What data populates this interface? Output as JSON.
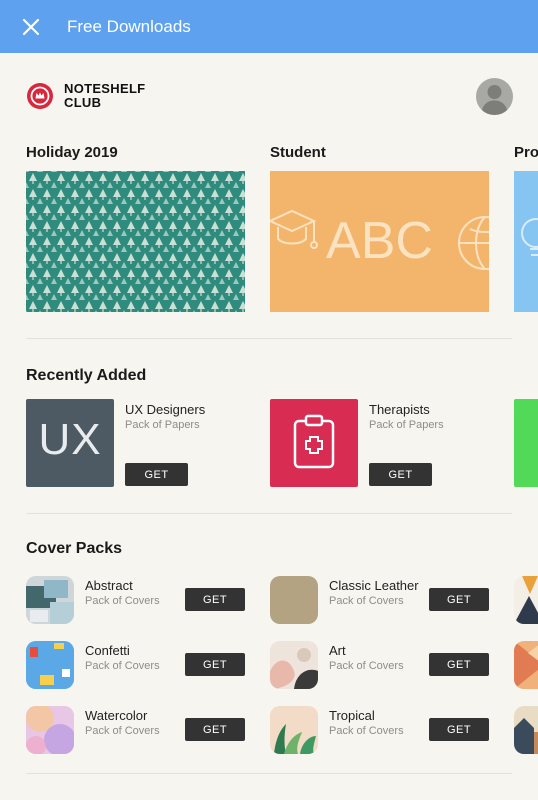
{
  "topbar": {
    "title": "Free Downloads"
  },
  "brand": {
    "line1": "NOTESHELF",
    "line2": "CLUB"
  },
  "featured": [
    {
      "label": "Holiday 2019"
    },
    {
      "label": "Student",
      "art_text": "ABC"
    },
    {
      "label": "Pro"
    }
  ],
  "recently_added": {
    "title": "Recently Added",
    "items": [
      {
        "title": "UX Designers",
        "subtitle": "Pack of Papers",
        "art_text": "UX",
        "action": "GET"
      },
      {
        "title": "Therapists",
        "subtitle": "Pack of Papers",
        "action": "GET"
      }
    ]
  },
  "cover_packs": {
    "title": "Cover Packs",
    "items": [
      {
        "title": "Abstract",
        "subtitle": "Pack of Covers",
        "action": "GET"
      },
      {
        "title": "Classic Leather",
        "subtitle": "Pack of Covers",
        "action": "GET"
      },
      {
        "title": "Confetti",
        "subtitle": "Pack of Covers",
        "action": "GET"
      },
      {
        "title": "Art",
        "subtitle": "Pack of Covers",
        "action": "GET"
      },
      {
        "title": "Watercolor",
        "subtitle": "Pack of Covers",
        "action": "GET"
      },
      {
        "title": "Tropical",
        "subtitle": "Pack of Covers",
        "action": "GET"
      }
    ]
  },
  "colors": {
    "topbar": "#5ea1ef",
    "background": "#f6f5ef",
    "button": "#333333",
    "brand_red": "#d8283e"
  }
}
